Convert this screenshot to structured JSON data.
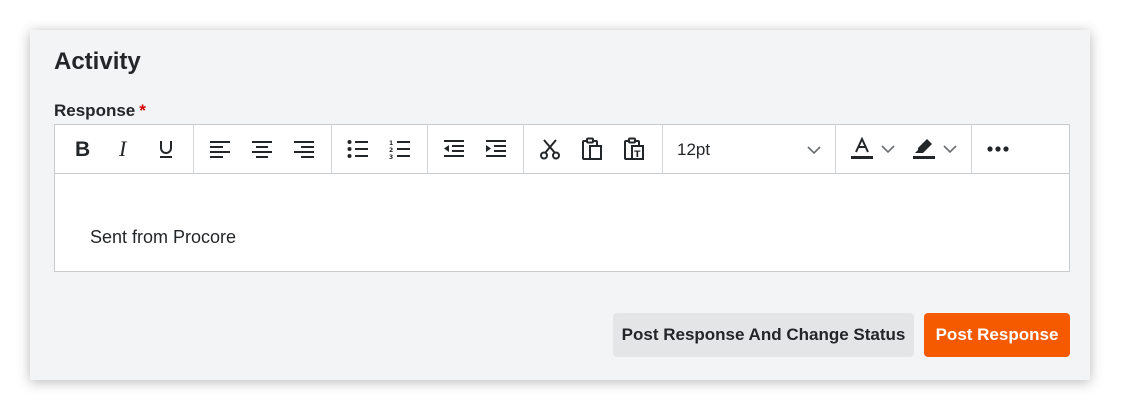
{
  "section": {
    "title": "Activity",
    "field_label": "Response",
    "required_marker": "*"
  },
  "toolbar": {
    "buttons": [
      {
        "name": "bold-icon"
      },
      {
        "name": "italic-icon"
      },
      {
        "name": "underline-icon"
      },
      {
        "name": "align-left-icon"
      },
      {
        "name": "align-center-icon"
      },
      {
        "name": "align-right-icon"
      },
      {
        "name": "bullet-list-icon"
      },
      {
        "name": "numbered-list-icon"
      },
      {
        "name": "outdent-icon"
      },
      {
        "name": "indent-icon"
      },
      {
        "name": "cut-icon"
      },
      {
        "name": "paste-icon"
      },
      {
        "name": "paste-as-text-icon"
      },
      {
        "name": "text-color-icon"
      },
      {
        "name": "highlight-color-icon"
      },
      {
        "name": "more-icon"
      }
    ],
    "font_size": "12pt"
  },
  "editor": {
    "content": "Sent from Procore"
  },
  "actions": {
    "secondary_label": "Post Response And Change Status",
    "primary_label": "Post Response"
  },
  "colors": {
    "primary": "#f55a00",
    "required": "#d40000",
    "panel_bg": "#f3f4f5",
    "text": "#232628"
  }
}
